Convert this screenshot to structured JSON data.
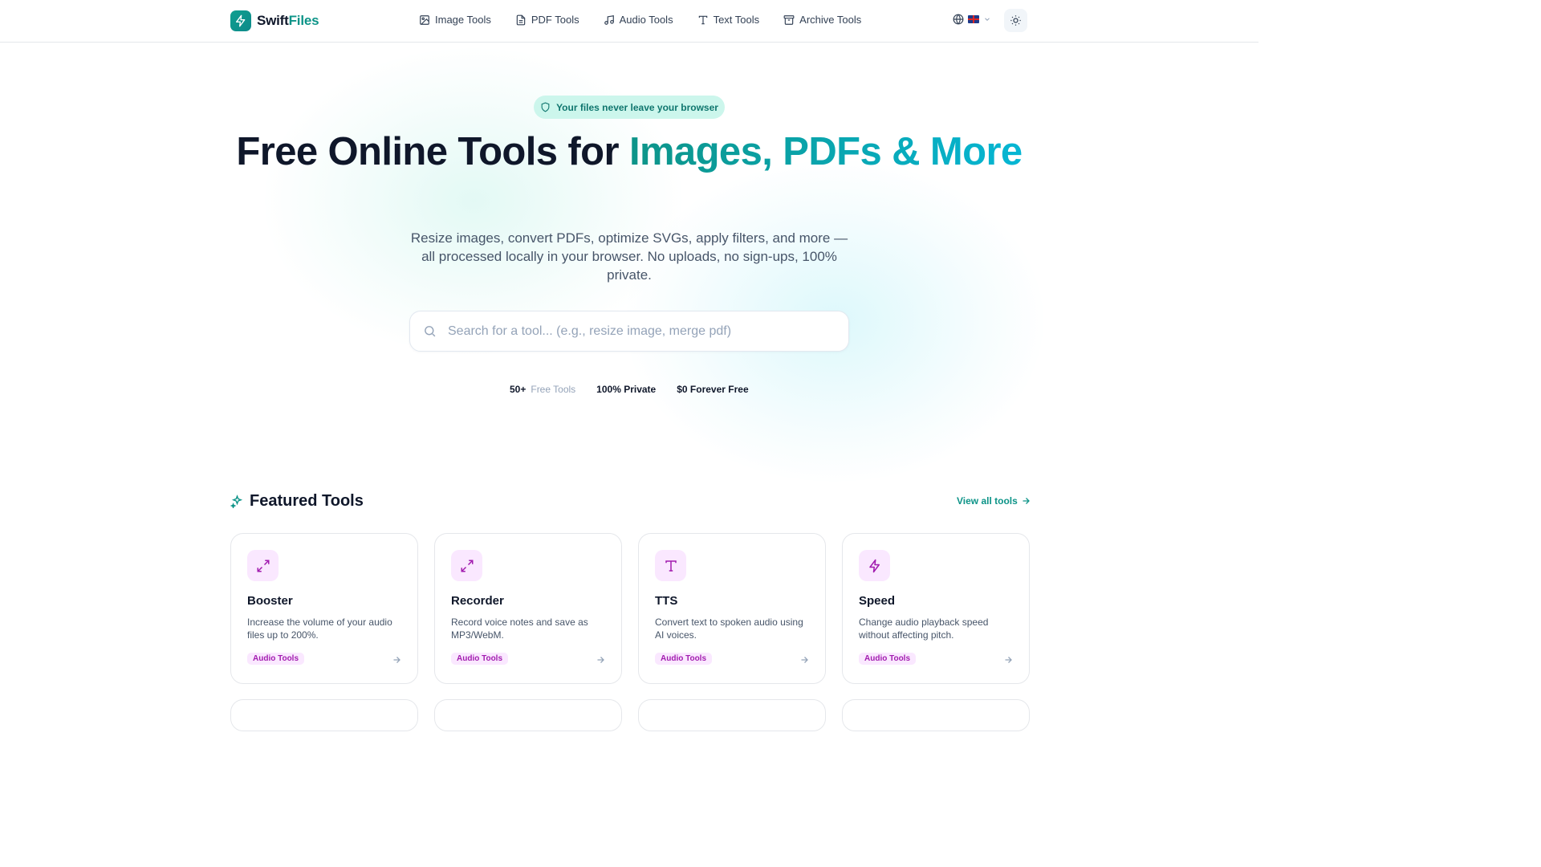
{
  "header": {
    "brand_a": "Swift",
    "brand_b": "Files",
    "nav": [
      {
        "label": "Image Tools",
        "icon": "image-icon"
      },
      {
        "label": "PDF Tools",
        "icon": "file-icon"
      },
      {
        "label": "Audio Tools",
        "icon": "music-icon"
      },
      {
        "label": "Text Tools",
        "icon": "text-icon"
      },
      {
        "label": "Archive Tools",
        "icon": "archive-icon"
      }
    ],
    "language_flag": "🇬🇧"
  },
  "hero": {
    "badge": "Your files never leave your browser",
    "title_plain": "Free Online Tools for ",
    "title_highlight": "Images, PDFs & More",
    "subtitle": "Resize images, convert PDFs, optimize SVGs, apply filters, and more — all processed locally in your browser. No uploads, no sign-ups, 100% private.",
    "search_placeholder": "Search for a tool... (e.g., resize image, merge pdf)",
    "stats": [
      {
        "value": "50+",
        "label": "Free Tools"
      },
      {
        "value": "100% Private",
        "label": ""
      },
      {
        "value": "$0 Forever Free",
        "label": ""
      }
    ]
  },
  "featured": {
    "title": "Featured Tools",
    "view_all": "View all tools",
    "cards": [
      {
        "title": "Booster",
        "desc": "Increase the volume of your audio files up to 200%.",
        "tag": "Audio Tools",
        "icon": "expand-icon"
      },
      {
        "title": "Recorder",
        "desc": "Record voice notes and save as MP3/WebM.",
        "tag": "Audio Tools",
        "icon": "expand-icon"
      },
      {
        "title": "TTS",
        "desc": "Convert text to spoken audio using AI voices.",
        "tag": "Audio Tools",
        "icon": "text-icon"
      },
      {
        "title": "Speed",
        "desc": "Change audio playback speed without affecting pitch.",
        "tag": "Audio Tools",
        "icon": "lightning-icon"
      }
    ]
  },
  "colors": {
    "accent": "#0d9488",
    "accent2": "#06b6d4",
    "tag_bg": "#fae8ff",
    "tag_fg": "#a21caf"
  }
}
